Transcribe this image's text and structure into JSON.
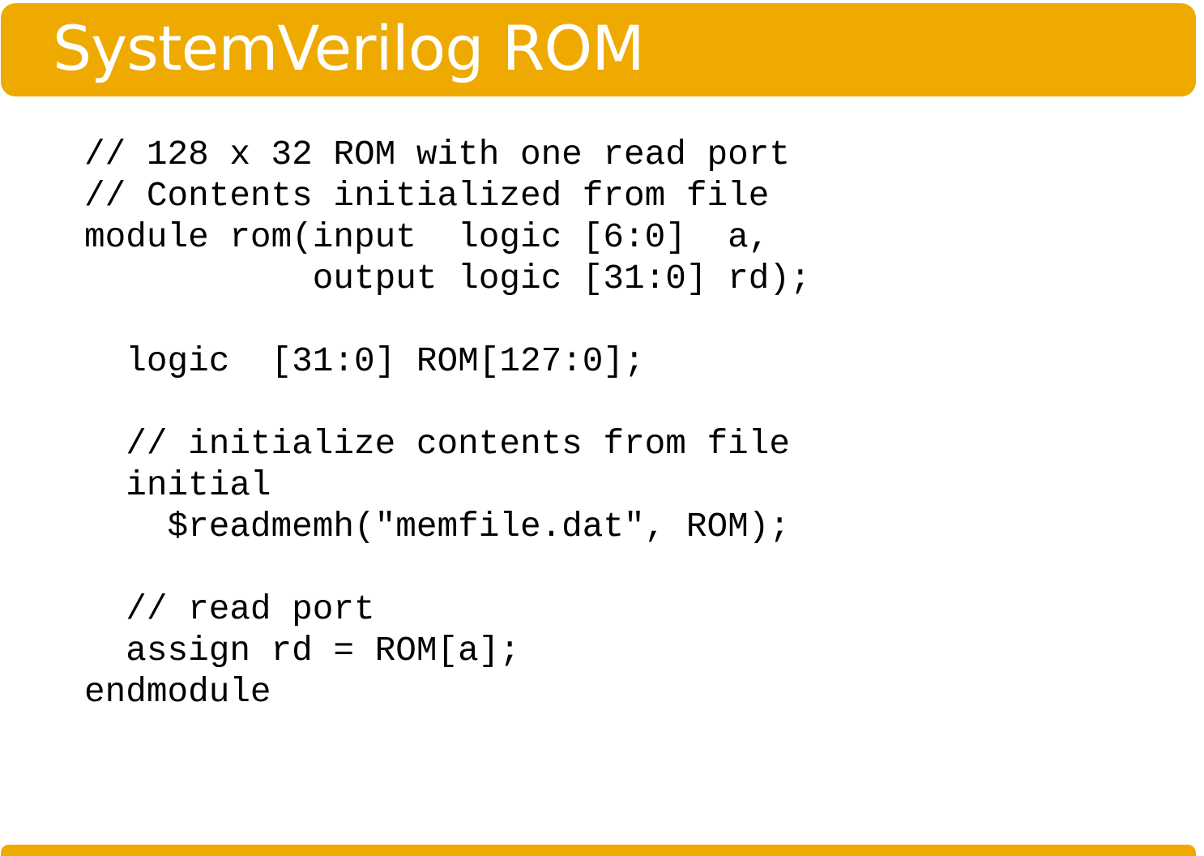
{
  "colors": {
    "accent": "#EEAA00",
    "title_text": "#FFFFFF",
    "code_text": "#000000",
    "background": "#FFFFFF"
  },
  "header": {
    "title": "SystemVerilog ROM"
  },
  "code": {
    "lines": [
      "// 128 x 32 ROM with one read port",
      "// Contents initialized from file",
      "module rom(input  logic [6:0]  a,",
      "           output logic [31:0] rd);",
      "",
      "  logic  [31:0] ROM[127:0];",
      "",
      "  // initialize contents from file",
      "  initial",
      "    $readmemh(\"memfile.dat\", ROM);",
      "",
      "  // read port",
      "  assign rd = ROM[a];",
      "endmodule"
    ]
  }
}
